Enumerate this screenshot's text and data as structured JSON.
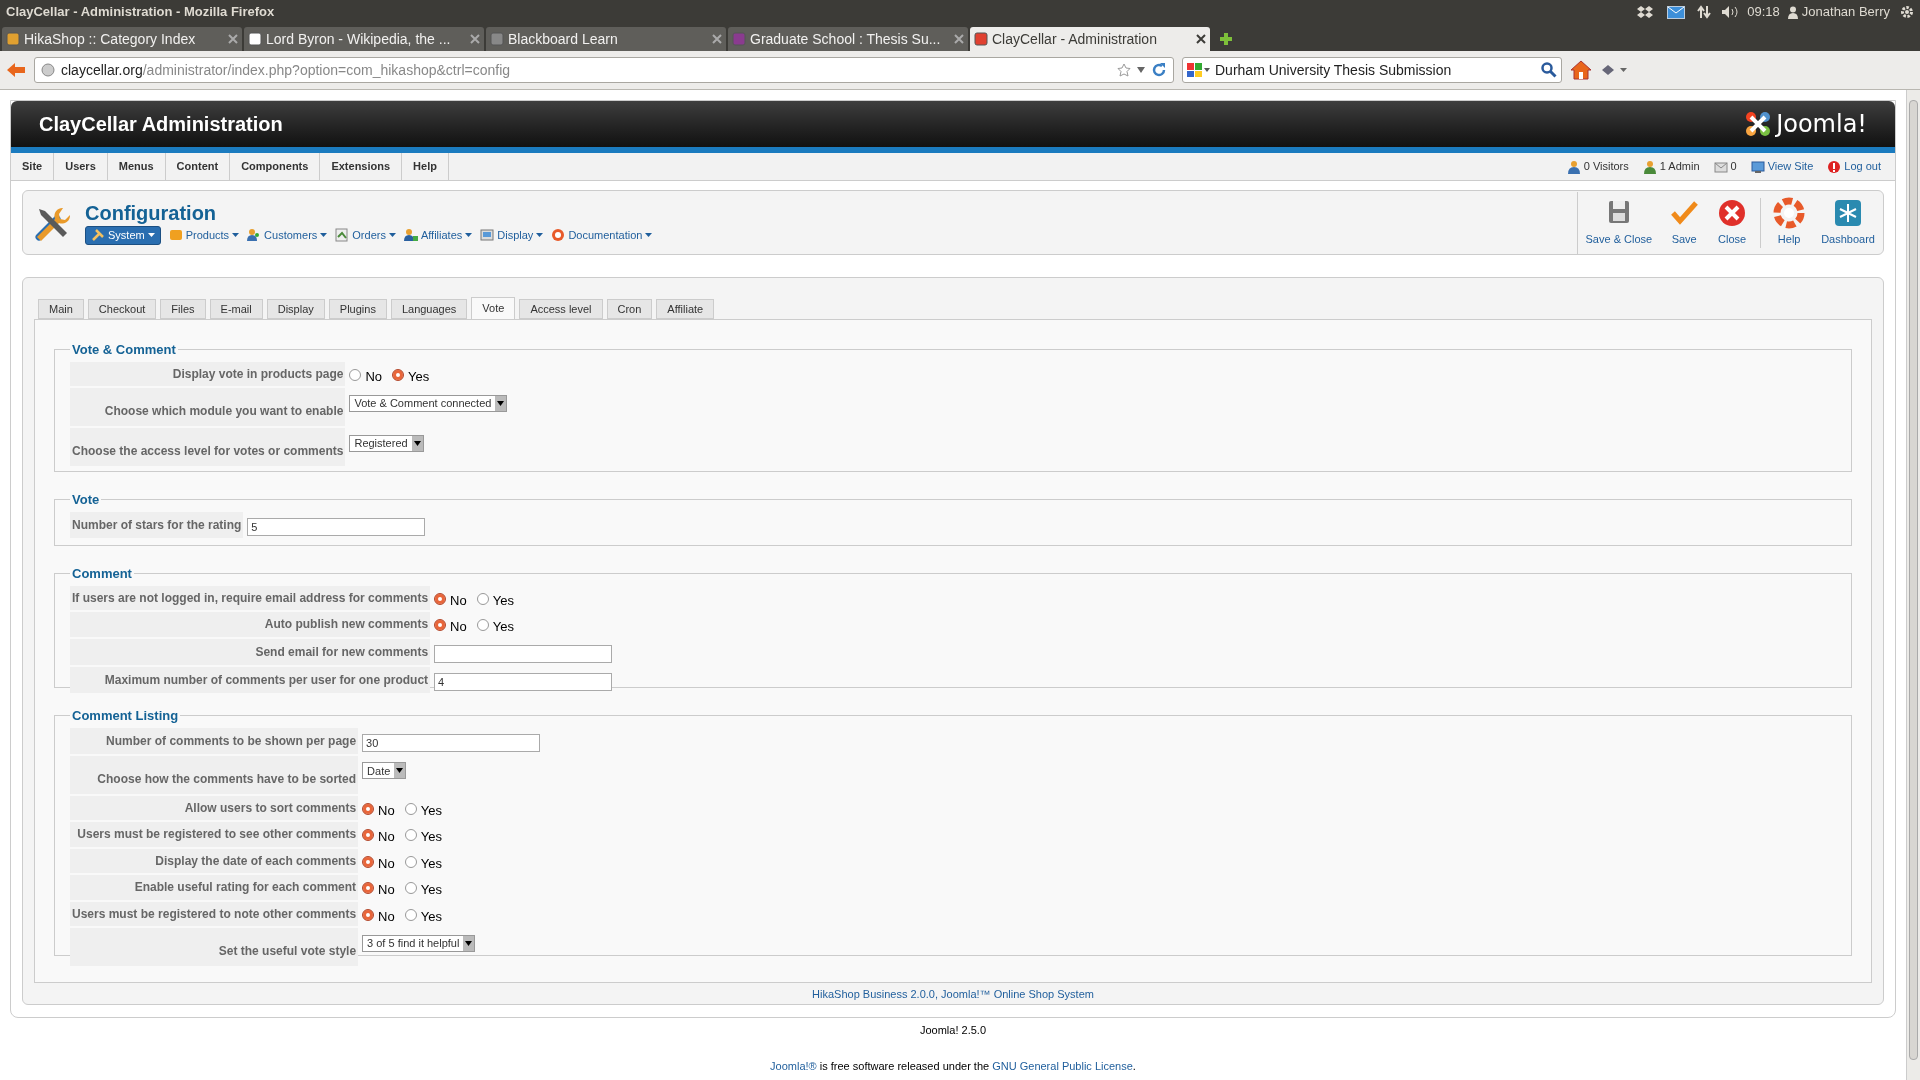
{
  "desktop_bar": {
    "title": "ClayCellar - Administration - Mozilla Firefox",
    "time": "09:18",
    "user": "Jonathan Berry"
  },
  "browser_tabs": [
    {
      "label": "HikaShop :: Category Index",
      "selected": false
    },
    {
      "label": "Lord Byron - Wikipedia, the ...",
      "selected": false
    },
    {
      "label": "Blackboard Learn",
      "selected": false
    },
    {
      "label": "Graduate School : Thesis Su...",
      "selected": false
    },
    {
      "label": "ClayCellar - Administration",
      "selected": true
    }
  ],
  "address_bar": {
    "host": "claycellar.org",
    "path": "/administrator/index.php?option=com_hikashop&ctrl=config"
  },
  "search_bar": {
    "value": "Durham University Thesis Submission"
  },
  "header": {
    "title": "ClayCellar Administration",
    "logo": "Joomla!"
  },
  "menu": [
    "Site",
    "Users",
    "Menus",
    "Content",
    "Components",
    "Extensions",
    "Help"
  ],
  "status": [
    {
      "kind": "visitors",
      "label": "0 Visitors"
    },
    {
      "kind": "admins",
      "label": "1 Admin"
    },
    {
      "kind": "messages",
      "label": "0"
    },
    {
      "kind": "view-site",
      "label": "View Site"
    },
    {
      "kind": "logout",
      "label": "Log out"
    }
  ],
  "toolbar": {
    "title": "Configuration",
    "submenu": [
      {
        "label": "System",
        "selected": true
      },
      {
        "label": "Products",
        "selected": false
      },
      {
        "label": "Customers",
        "selected": false
      },
      {
        "label": "Orders",
        "selected": false
      },
      {
        "label": "Affiliates",
        "selected": false
      },
      {
        "label": "Display",
        "selected": false
      },
      {
        "label": "Documentation",
        "selected": false
      }
    ],
    "buttons": [
      {
        "kind": "save-close",
        "label": "Save & Close"
      },
      {
        "kind": "save",
        "label": "Save"
      },
      {
        "kind": "close",
        "label": "Close"
      },
      {
        "kind": "help",
        "label": "Help"
      },
      {
        "kind": "dashboard",
        "label": "Dashboard"
      }
    ]
  },
  "tabs": [
    {
      "label": "Main",
      "selected": false
    },
    {
      "label": "Checkout",
      "selected": false
    },
    {
      "label": "Files",
      "selected": false
    },
    {
      "label": "E-mail",
      "selected": false
    },
    {
      "label": "Display",
      "selected": false
    },
    {
      "label": "Plugins",
      "selected": false
    },
    {
      "label": "Languages",
      "selected": false
    },
    {
      "label": "Vote",
      "selected": true
    },
    {
      "label": "Access level",
      "selected": false
    },
    {
      "label": "Cron",
      "selected": false
    },
    {
      "label": "Affiliate",
      "selected": false
    }
  ],
  "sections": [
    {
      "legend": "Vote & Comment",
      "rows": [
        {
          "kind": "radio",
          "label": "Display vote in products page",
          "options": [
            {
              "label": "No",
              "selected": false
            },
            {
              "label": "Yes",
              "selected": true
            }
          ]
        },
        {
          "kind": "select",
          "label": "Choose which module you want to enable",
          "value": "Vote & Comment connected"
        },
        {
          "kind": "select",
          "label": "Choose the access level for votes or comments",
          "value": "Registered"
        }
      ]
    },
    {
      "legend": "Vote",
      "rows": [
        {
          "kind": "text",
          "label": "Number of stars for the rating",
          "value": "5"
        }
      ]
    },
    {
      "legend": "Comment",
      "rows": [
        {
          "kind": "radio",
          "label": "If users are not logged in, require email address for comments",
          "options": [
            {
              "label": "No",
              "selected": true
            },
            {
              "label": "Yes",
              "selected": false
            }
          ]
        },
        {
          "kind": "radio",
          "label": "Auto publish new comments",
          "options": [
            {
              "label": "No",
              "selected": true
            },
            {
              "label": "Yes",
              "selected": false
            }
          ]
        },
        {
          "kind": "text",
          "label": "Send email for new comments"
        },
        {
          "kind": "text",
          "label": "Maximum number of comments per user for one product",
          "value": "4"
        }
      ]
    },
    {
      "legend": "Comment Listing",
      "rows": [
        {
          "kind": "text",
          "label": "Number of comments to be shown per page",
          "value": "30"
        },
        {
          "kind": "select",
          "label": "Choose how the comments have to be sorted",
          "value": "Date"
        },
        {
          "kind": "radio",
          "label": "Allow users to sort comments",
          "options": [
            {
              "label": "No",
              "selected": true
            },
            {
              "label": "Yes",
              "selected": false
            }
          ]
        },
        {
          "kind": "radio",
          "label": "Users must be registered to see other comments",
          "options": [
            {
              "label": "No",
              "selected": true
            },
            {
              "label": "Yes",
              "selected": false
            }
          ]
        },
        {
          "kind": "radio",
          "label": "Display the date of each comments",
          "options": [
            {
              "label": "No",
              "selected": true
            },
            {
              "label": "Yes",
              "selected": false
            }
          ]
        },
        {
          "kind": "radio",
          "label": "Enable useful rating for each comment",
          "options": [
            {
              "label": "No",
              "selected": true
            },
            {
              "label": "Yes",
              "selected": false
            }
          ]
        },
        {
          "kind": "radio",
          "label": "Users must be registered to note other comments",
          "options": [
            {
              "label": "No",
              "selected": true
            },
            {
              "label": "Yes",
              "selected": false
            }
          ]
        },
        {
          "kind": "select",
          "label": "Set the useful vote style",
          "value": "3 of 5 find it helpful"
        }
      ]
    }
  ],
  "footer": {
    "credit": "HikaShop Business 2.0.0, Joomla!™ Online Shop System",
    "version": "Joomla! 2.5.0",
    "license": [
      {
        "text": "Joomla!®",
        "link": true
      },
      {
        "text": " is free software released under the ",
        "link": false
      },
      {
        "text": "GNU General Public License",
        "link": true
      },
      {
        "text": ".",
        "link": false
      }
    ]
  }
}
